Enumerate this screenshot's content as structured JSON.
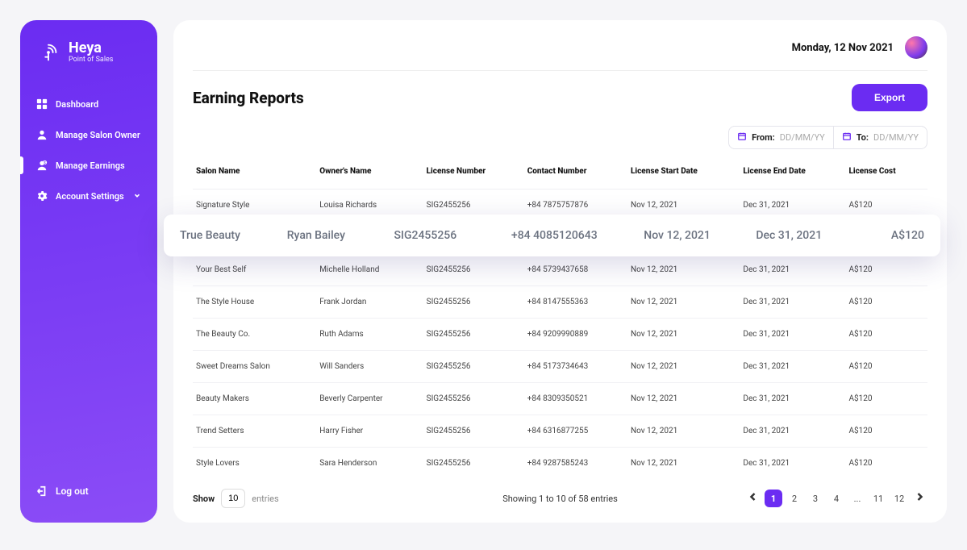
{
  "brand": {
    "name": "Heya",
    "subtitle": "Point of Sales"
  },
  "sidebar": {
    "items": [
      {
        "label": "Dashboard"
      },
      {
        "label": "Manage Salon Owner"
      },
      {
        "label": "Manage Earnings"
      },
      {
        "label": "Account Settings"
      }
    ]
  },
  "logout": {
    "label": "Log out"
  },
  "topbar": {
    "date": "Monday, 12 Nov 2021"
  },
  "page": {
    "title": "Earning Reports"
  },
  "buttons": {
    "export": "Export"
  },
  "filters": {
    "from_label": "From:",
    "to_label": "To:",
    "placeholder": "DD/MM/YY"
  },
  "table": {
    "headers": [
      "Salon Name",
      "Owner's Name",
      "License Number",
      "Contact Number",
      "License Start Date",
      "License End Date",
      "License Cost"
    ],
    "rows": [
      {
        "salon": "Signature Style",
        "owner": "Louisa Richards",
        "license": "SIG2455256",
        "contact": "+84 7875757876",
        "start": "Nov 12, 2021",
        "end": "Dec 31, 2021",
        "cost": "A$120"
      },
      {
        "salon": "True Beauty",
        "owner": "Ryan Bailey",
        "license": "SIG2455256",
        "contact": "+84 4085120643",
        "start": "Nov 12, 2021",
        "end": "Dec 31, 2021",
        "cost": "A$120"
      },
      {
        "salon": "Your Best Self",
        "owner": "Michelle Holland",
        "license": "SIG2455256",
        "contact": "+84 5739437658",
        "start": "Nov 12, 2021",
        "end": "Dec 31, 2021",
        "cost": "A$120"
      },
      {
        "salon": "The Style House",
        "owner": "Frank Jordan",
        "license": "SIG2455256",
        "contact": "+84 8147555363",
        "start": "Nov 12, 2021",
        "end": "Dec 31, 2021",
        "cost": "A$120"
      },
      {
        "salon": "The Beauty Co.",
        "owner": "Ruth Adams",
        "license": "SIG2455256",
        "contact": "+84 9209990889",
        "start": "Nov 12, 2021",
        "end": "Dec 31, 2021",
        "cost": "A$120"
      },
      {
        "salon": "Sweet Dreams Salon",
        "owner": "Will Sanders",
        "license": "SIG2455256",
        "contact": "+84 5173734643",
        "start": "Nov 12, 2021",
        "end": "Dec 31, 2021",
        "cost": "A$120"
      },
      {
        "salon": "Beauty Makers",
        "owner": "Beverly Carpenter",
        "license": "SIG2455256",
        "contact": "+84 8309350521",
        "start": "Nov 12, 2021",
        "end": "Dec 31, 2021",
        "cost": "A$120"
      },
      {
        "salon": "Trend Setters",
        "owner": "Harry Fisher",
        "license": "SIG2455256",
        "contact": "+84 6316877255",
        "start": "Nov 12, 2021",
        "end": "Dec 31, 2021",
        "cost": "A$120"
      },
      {
        "salon": "Style Lovers",
        "owner": "Sara Henderson",
        "license": "SIG2455256",
        "contact": "+84 9287585243",
        "start": "Nov 12, 2021",
        "end": "Dec 31, 2021",
        "cost": "A$120"
      }
    ],
    "highlighted_index": 1
  },
  "footer": {
    "show_label": "Show",
    "entries_value": "10",
    "entries_label": "entries",
    "summary": "Showing 1 to 10 of 58 entries",
    "pages": [
      "1",
      "2",
      "3",
      "4",
      "...",
      "11",
      "12"
    ],
    "active_page": "1"
  }
}
